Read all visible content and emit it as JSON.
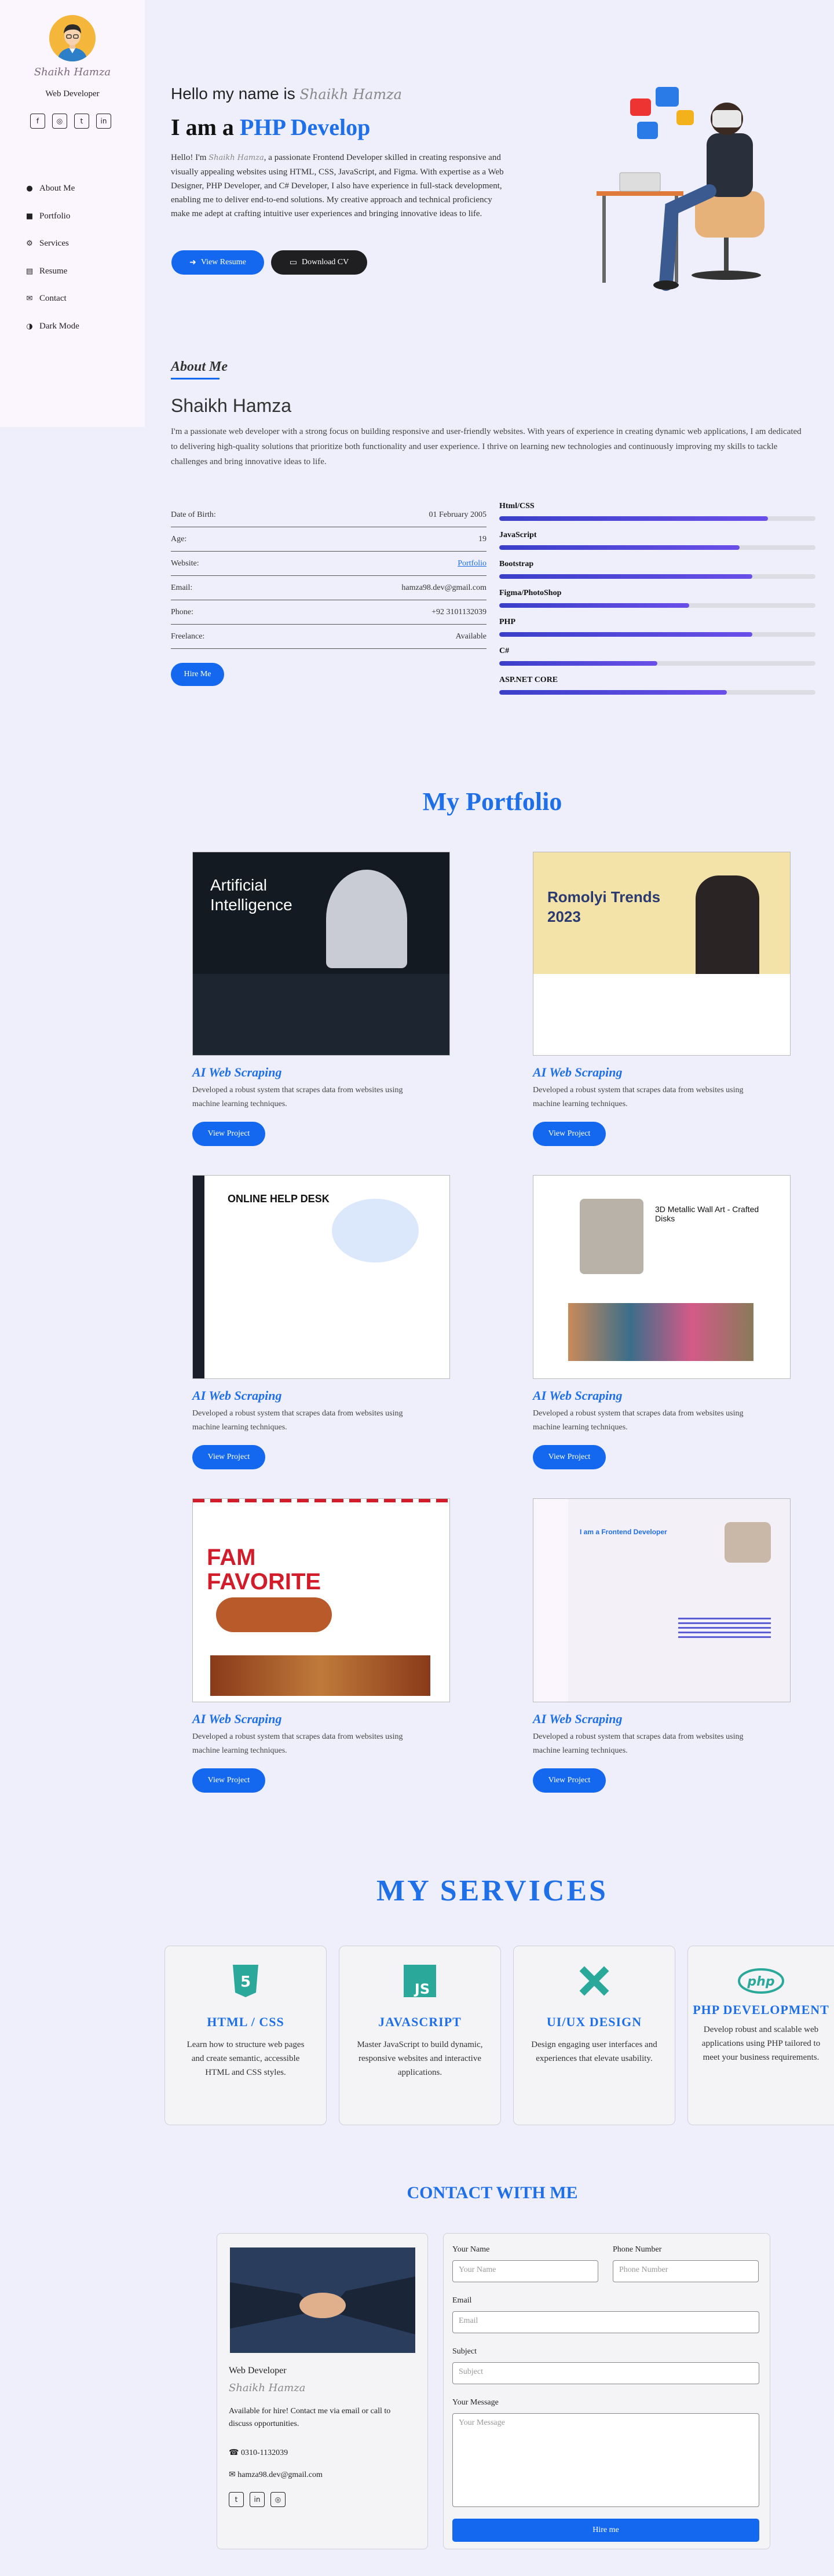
{
  "sidebar": {
    "name": "Shaikh Hamza",
    "role": "Web Developer",
    "social": [
      "f",
      "◎",
      "t",
      "in"
    ],
    "nav": [
      {
        "icon": "user-icon",
        "label": "About Me"
      },
      {
        "icon": "briefcase-icon",
        "label": "Portfolio"
      },
      {
        "icon": "gears-icon",
        "label": "Services"
      },
      {
        "icon": "document-icon",
        "label": "Resume"
      },
      {
        "icon": "envelope-icon",
        "label": "Contact"
      },
      {
        "icon": "contrast-icon",
        "label": "Dark Mode"
      }
    ]
  },
  "hero": {
    "hello": "Hello my name is",
    "sig": "Shaikh Hamza",
    "iam": "I am a",
    "role": "PHP Develop",
    "intro_a": "Hello! I'm",
    "intro_sig": "Shaikh Hamza",
    "intro_b": ", a passionate Frontend Developer skilled in creating responsive and visually appealing websites using HTML, CSS, JavaScript, and Figma. With expertise as a Web Designer, PHP Developer, and C# Developer, I also have experience in full-stack development, enabling me to deliver end-to-end solutions. My creative approach and technical proficiency make me adept at crafting intuitive user experiences and bringing innovative ideas to life.",
    "btn_resume": "View Resume",
    "btn_cv": "Download CV"
  },
  "about": {
    "label": "About Me",
    "name": "Shaikh Hamza",
    "text": "I'm a passionate web developer with a strong focus on building responsive and user-friendly websites. With years of experience in creating dynamic web applications, I am dedicated to delivering high-quality solutions that prioritize both functionality and user experience. I thrive on learning new technologies and continuously improving my skills to tackle challenges and bring innovative ideas to life.",
    "info": [
      {
        "k": "Date of Birth:",
        "v": "01 February 2005"
      },
      {
        "k": "Age:",
        "v": "19"
      },
      {
        "k": "Website:",
        "v": "Portfolio"
      },
      {
        "k": "Email:",
        "v": "hamza98.dev@gmail.com"
      },
      {
        "k": "Phone:",
        "v": "+92 3101132039"
      },
      {
        "k": "Freelance:",
        "v": "Available"
      }
    ],
    "hire": "Hire Me",
    "skills": [
      {
        "name": "Html/CSS",
        "level": 0.85
      },
      {
        "name": "JavaScript",
        "level": 0.76
      },
      {
        "name": "Bootstrap",
        "level": 0.8
      },
      {
        "name": "Figma/PhotoShop",
        "level": 0.6
      },
      {
        "name": "PHP",
        "level": 0.8
      },
      {
        "name": "C#",
        "level": 0.5
      },
      {
        "name": "ASP.NET CORE",
        "level": 0.72
      }
    ]
  },
  "portfolio": {
    "title": "My Portfolio",
    "cards": [
      {
        "title": "AI Web Scraping",
        "desc": "Developed a robust system that scrapes data from websites using machine learning techniques.",
        "btn": "View Project",
        "shot_text": "Artificial Intelligence"
      },
      {
        "title": "AI Web Scraping",
        "desc": "Developed a robust system that scrapes data from websites using machine learning techniques.",
        "btn": "View Project",
        "shot_text": "Romolyi Trends 2023"
      },
      {
        "title": "AI Web Scraping",
        "desc": "Developed a robust system that scrapes data from websites using machine learning techniques.",
        "btn": "View Project",
        "shot_text": "ONLINE HELP DESK"
      },
      {
        "title": "AI Web Scraping",
        "desc": "Developed a robust system that scrapes data from websites using machine learning techniques.",
        "btn": "View Project",
        "shot_text": "3D Metallic Wall Art - Crafted Disks"
      },
      {
        "title": "AI Web Scraping",
        "desc": "Developed a robust system that scrapes data from websites using machine learning techniques.",
        "btn": "View Project",
        "shot_text": "FAM FAVORITE"
      },
      {
        "title": "AI Web Scraping",
        "desc": "Developed a robust system that scrapes data from websites using machine learning techniques.",
        "btn": "View Project",
        "shot_text": "I am a Frontend Developer"
      }
    ]
  },
  "services": {
    "title": "MY SERVICES",
    "items": [
      {
        "name": "HTML / CSS",
        "desc": "Learn how to structure web pages and create semantic, accessible HTML and CSS styles.",
        "icon": "html5-icon",
        "color": "#2aa89a"
      },
      {
        "name": "JAVASCRIPT",
        "desc": "Master JavaScript to build dynamic, responsive websites and interactive applications.",
        "icon": "js-icon",
        "color": "#2aa89a"
      },
      {
        "name": "UI/UX DESIGN",
        "desc": "Design engaging user interfaces and experiences that elevate usability.",
        "icon": "pencil-ruler-icon",
        "color": "#2aa89a"
      },
      {
        "name": "PHP DEVELOPMENT",
        "desc": "Develop robust and scalable web applications using PHP tailored to meet your business requirements.",
        "icon": "php-icon",
        "color": "#2aa89a"
      }
    ]
  },
  "contact": {
    "title": "CONTACT WITH ME",
    "role": "Web Developer",
    "sig": "Shaikh Hamza",
    "avail": "Available for hire! Contact me via email or call to discuss opportunities.",
    "phone": "0310-1132039",
    "email": "hamza98.dev@gmail.com",
    "social": [
      "t",
      "in",
      "◎"
    ],
    "form": {
      "name_label": "Your Name",
      "name_ph": "Your Name",
      "phone_label": "Phone Number",
      "phone_ph": "Phone Number",
      "email_label": "Email",
      "email_ph": "Email",
      "subject_label": "Subject",
      "subject_ph": "Subject",
      "message_label": "Your Message",
      "message_ph": "Your Message",
      "submit": "Hire me"
    }
  }
}
